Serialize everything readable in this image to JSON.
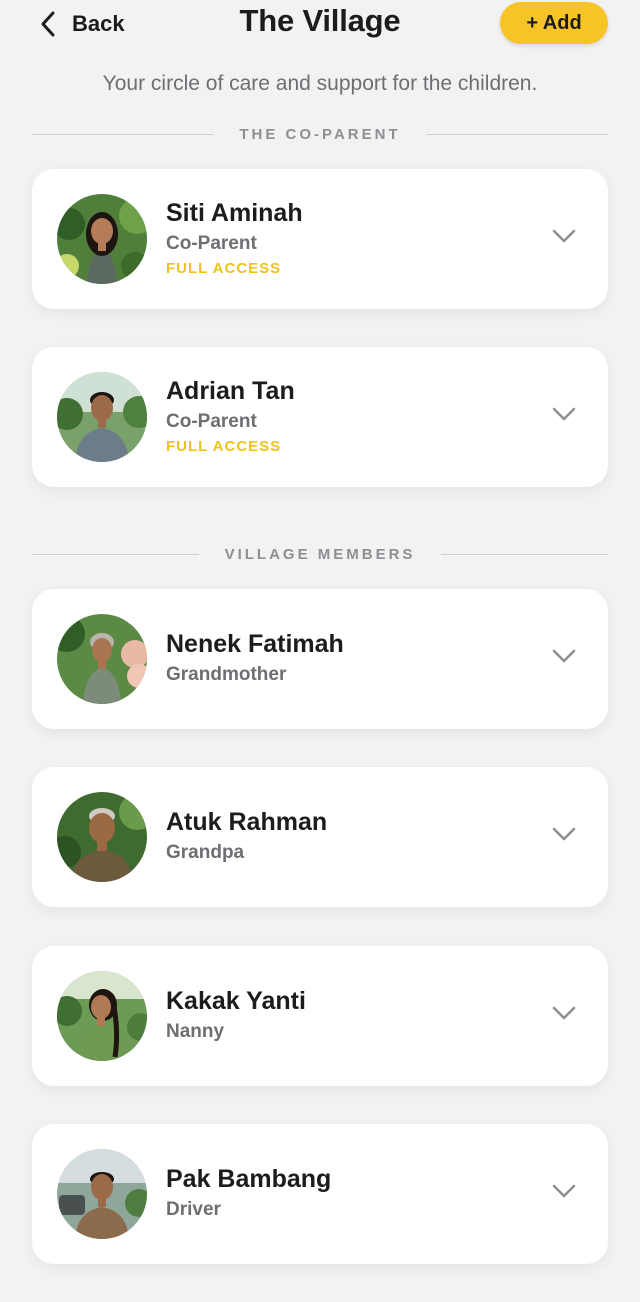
{
  "header": {
    "back_label": "Back",
    "title": "The Village",
    "add_label": "+ Add"
  },
  "subtitle": "Your circle of care and support for the children.",
  "sections": {
    "co_parent": "THE CO-PARENT",
    "village": "VILLAGE MEMBERS"
  },
  "co_parents": [
    {
      "name": "Siti Aminah",
      "role": "Co-Parent",
      "access": "FULL ACCESS"
    },
    {
      "name": "Adrian Tan",
      "role": "Co-Parent",
      "access": "FULL ACCESS"
    }
  ],
  "members": [
    {
      "name": "Nenek Fatimah",
      "role": "Grandmother"
    },
    {
      "name": "Atuk Rahman",
      "role": "Grandpa"
    },
    {
      "name": "Kakak Yanti",
      "role": "Nanny"
    },
    {
      "name": "Pak Bambang",
      "role": "Driver"
    }
  ],
  "colors": {
    "accent": "#f6c426",
    "access_text": "#f0c21c",
    "background": "#f2f2f3",
    "card": "#ffffff",
    "muted_text": "#6e6e73"
  },
  "icons": {
    "back": "chevron-left-icon",
    "expand": "chevron-down-icon"
  }
}
